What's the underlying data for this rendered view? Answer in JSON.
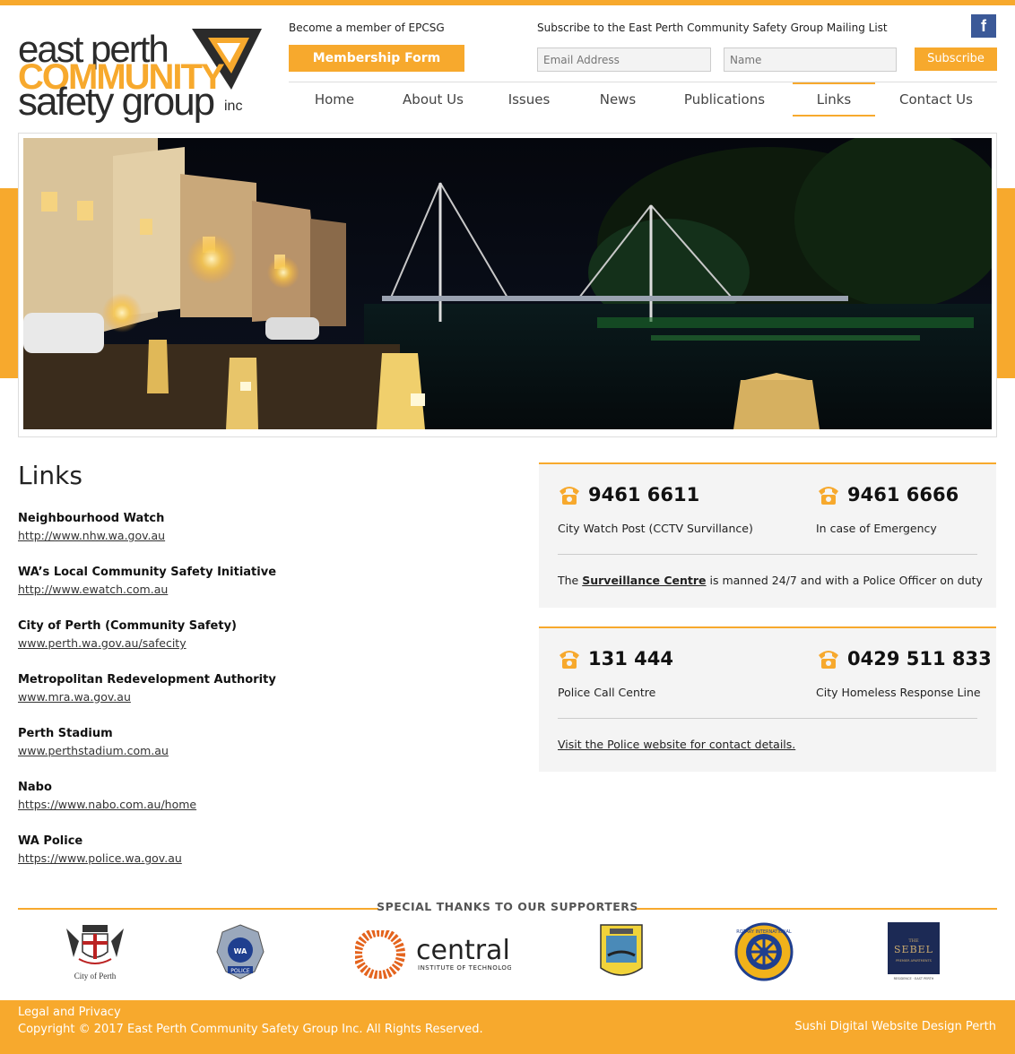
{
  "logo": {
    "line1": "east perth",
    "line2": "COMMUNITY",
    "line3": "safety group",
    "suffix": "inc"
  },
  "header": {
    "member_text": "Become a member of EPCSG",
    "member_button": "Membership Form",
    "subscribe_text": "Subscribe to the East Perth Community Safety Group Mailing List",
    "email_placeholder": "Email Address",
    "name_placeholder": "Name",
    "subscribe_button": "Subscribe",
    "facebook_icon": "facebook-icon"
  },
  "nav": {
    "items": [
      "Home",
      "About Us",
      "Issues",
      "News",
      "Publications",
      "Links",
      "Contact Us"
    ],
    "active": "Links"
  },
  "links": {
    "title": "Links",
    "items": [
      {
        "name": "Neighbourhood Watch",
        "url": "http://www.nhw.wa.gov.au"
      },
      {
        "name": "WA’s Local Community Safety Initiative",
        "url": "http://www.ewatch.com.au"
      },
      {
        "name": "City of Perth (Community Safety)",
        "url": "www.perth.wa.gov.au/safecity"
      },
      {
        "name": "Metropolitan Redevelopment Authority",
        "url": "www.mra.wa.gov.au"
      },
      {
        "name": "Perth Stadium",
        "url": "www.perthstadium.com.au"
      },
      {
        "name": "Nabo",
        "url": "https://www.nabo.com.au/home"
      },
      {
        "name": "WA Police",
        "url": "https://www.police.wa.gov.au"
      }
    ]
  },
  "contacts": {
    "box1": {
      "left_number": "9461 6611",
      "left_label": "City Watch Post (CCTV Survillance)",
      "right_number": "9461 6666",
      "right_label": "In case of Emergency",
      "note_prefix": "The ",
      "note_link": "Surveillance Centre",
      "note_suffix": " is manned 24/7 and with a Police Officer on duty"
    },
    "box2": {
      "left_number": "131 444",
      "left_label": "Police Call Centre",
      "right_number": "0429 511 833",
      "right_label": "City Homeless Response Line",
      "note": "Visit the Police website for contact details."
    },
    "icon": "phone-icon"
  },
  "supporters": {
    "title": "SPECIAL THANKS TO OUR SUPPORTERS",
    "city_of_perth": "City of Perth",
    "police": "POLICE",
    "wa": "WA",
    "central": "central",
    "central_sub": "INSTITUTE OF TECHNOLOGY",
    "rotary_text": "ROTARY INTERNATIONAL",
    "sebel_the": "THE",
    "sebel": "SEBEL",
    "sebel_sub1": "PREMIER APARTMENTS",
    "sebel_sub2": "RESIDENCE · EAST PERTH"
  },
  "footer": {
    "legal": "Legal and Privacy",
    "copyright": "Copyright © 2017 East Perth Community Safety Group Inc. All Rights Reserved.",
    "credit": "Sushi Digital Website Design Perth"
  },
  "colors": {
    "accent": "#f7a92d",
    "facebook": "#3b5998",
    "panel": "#f4f4f4"
  }
}
